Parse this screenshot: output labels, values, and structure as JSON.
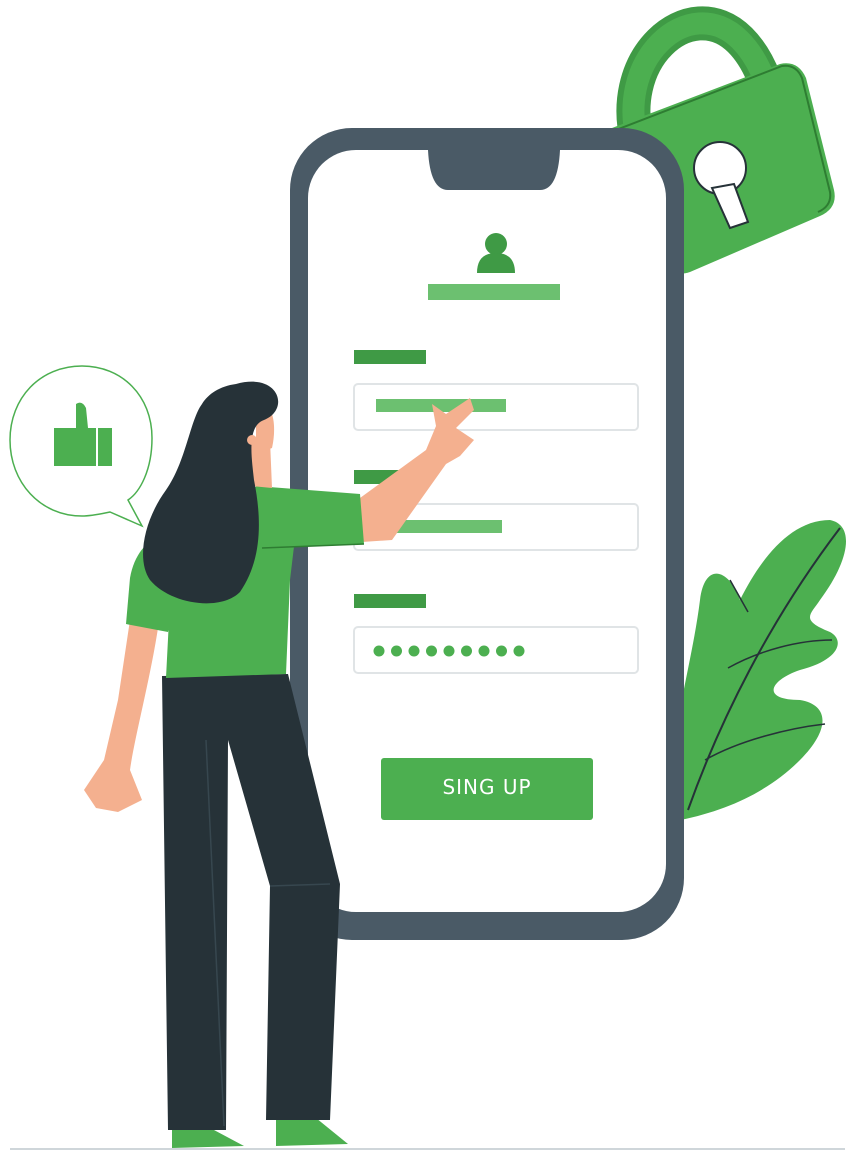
{
  "signup_form": {
    "avatar_icon": "user-icon",
    "password_dots": 9,
    "submit_label": "SING UP"
  },
  "decorations": {
    "lock_icon": "padlock-icon",
    "thumbs_up_icon": "thumbs-up-icon",
    "leaf_icon": "leaf-icon"
  },
  "colors": {
    "brand_green": "#4caf50",
    "dark_green": "#3f9a45",
    "light_green": "#6cc070",
    "phone_frame": "#4a5a66",
    "hair_dark": "#263238",
    "skin": "#f4b08f"
  }
}
